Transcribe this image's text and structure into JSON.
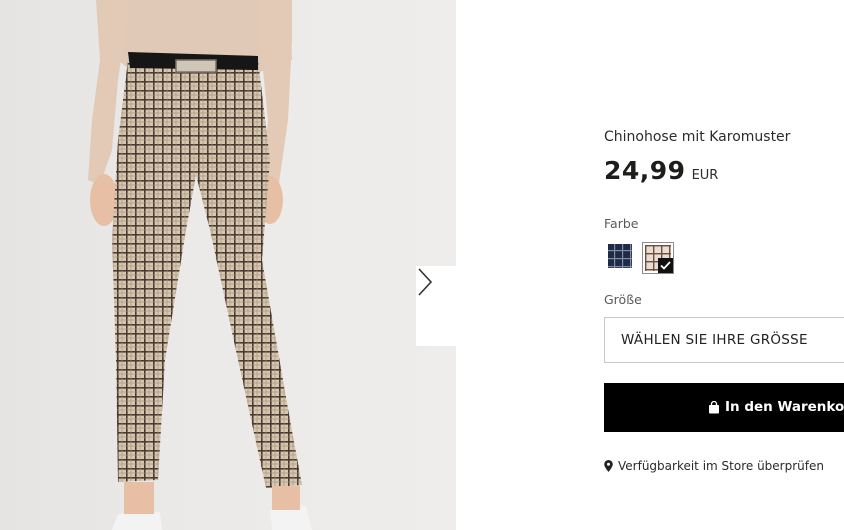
{
  "product": {
    "title": "Chinohose mit Karomuster",
    "price_amount": "24,99",
    "price_currency": "EUR"
  },
  "colors": {
    "label": "Farbe",
    "options": [
      {
        "name": "navy-check",
        "selected": false
      },
      {
        "name": "beige-check",
        "selected": true
      }
    ]
  },
  "size": {
    "label": "Größe",
    "select_text": "WÄHLEN SIE IHRE GRÖSSE"
  },
  "cart": {
    "button_label": "In den Warenkorb",
    "icon": "shopping-bag-icon"
  },
  "store": {
    "link_label": "Verfügbarkeit im Store überprüfen",
    "icon": "location-pin-icon"
  },
  "gallery": {
    "next_icon": "chevron-right-icon"
  },
  "theme": {
    "accent": "#000000",
    "text": "#1d1d1b",
    "border": "#c8c8c8"
  }
}
